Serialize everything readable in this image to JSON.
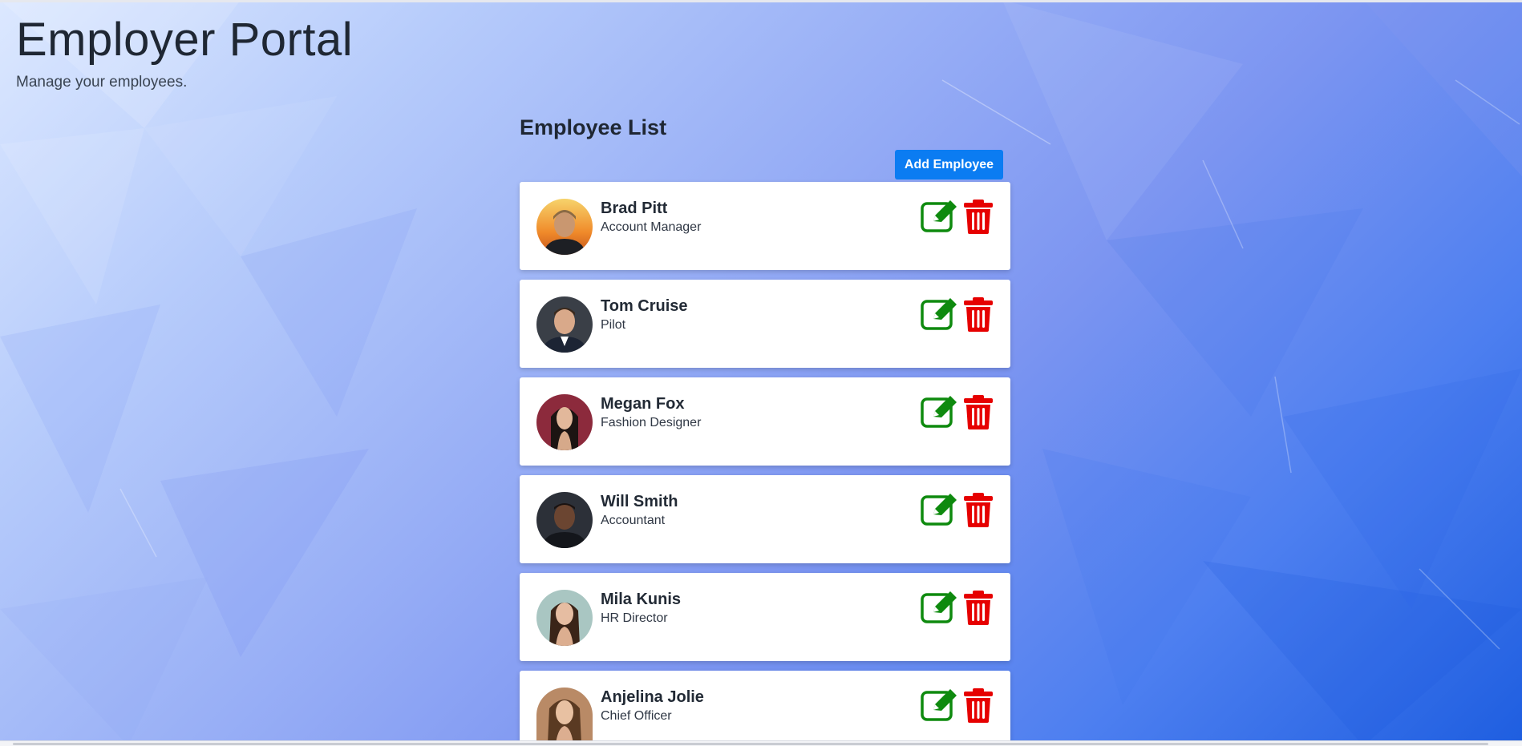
{
  "header": {
    "title": "Employer Portal",
    "subtitle": "Manage your employees."
  },
  "employee_list": {
    "heading": "Employee List",
    "add_button_label": "Add Employee",
    "employees": [
      {
        "name": "Brad Pitt",
        "role": "Account Manager"
      },
      {
        "name": "Tom Cruise",
        "role": "Pilot"
      },
      {
        "name": "Megan Fox",
        "role": "Fashion Designer"
      },
      {
        "name": "Will Smith",
        "role": "Accountant"
      },
      {
        "name": "Mila Kunis",
        "role": "HR Director"
      },
      {
        "name": "Anjelina Jolie",
        "role": "Chief Officer"
      }
    ]
  },
  "icons": {
    "edit": "edit-icon",
    "delete": "trash-icon"
  },
  "colors": {
    "primary_button": "#0b7cf2",
    "edit_green": "#0e8a0e",
    "delete_red": "#e60000"
  }
}
